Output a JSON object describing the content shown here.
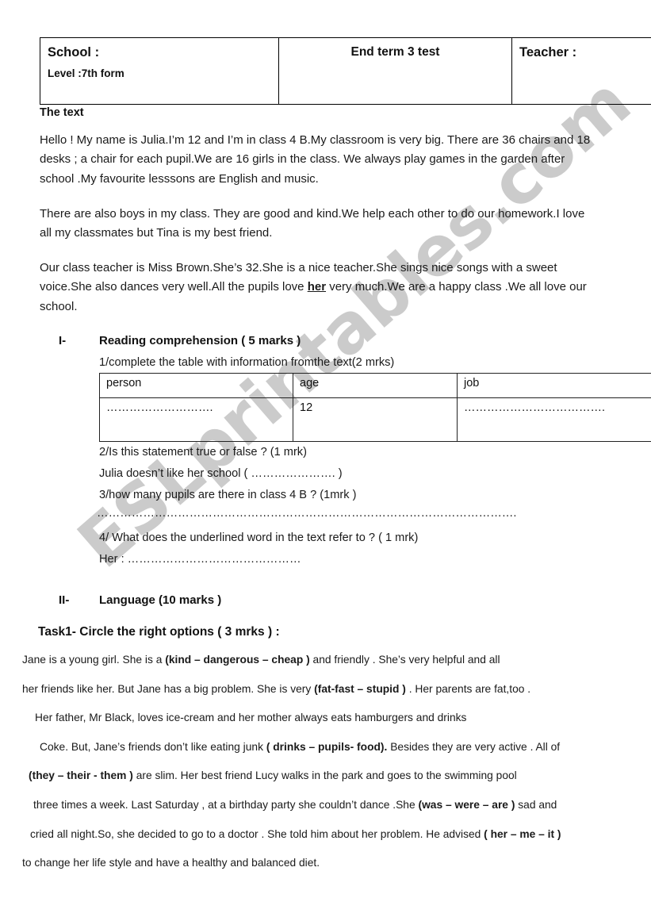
{
  "header": {
    "school_label": "School :",
    "level_label": "Level :7th form",
    "test_title": "End term 3 test",
    "teacher_label": "Teacher :"
  },
  "text_section": {
    "title": "The text",
    "paragraphs": [
      "Hello ! My name is Julia.I’m 12 and I’m in class 4 B.My classroom is very big. There are 36 chairs and 18 desks ; a chair for each pupil.We are 16 girls in the class. We always play games in the garden after school .My favourite lesssons are English and music.",
      "There are also boys in my class. They are good and kind.We help each other to do our homework.I love all my classmates but Tina is my best friend.",
      "Our class teacher is Miss Brown.She’s 32.She is a nice teacher.She sings nice songs with a sweet voice.She also dances very well.All the pupils  love ",
      " very much.We are a happy class .We all love our school."
    ],
    "underlined_word": "her"
  },
  "part_one": {
    "numeral": "I-",
    "title": "Reading comprehension ( 5 marks )",
    "q1": "1/complete the table with information fromthe text(2 mrks)",
    "table": {
      "headers": [
        "person",
        "age",
        "job"
      ],
      "row": [
        "……………………….",
        "12",
        "………………………………."
      ]
    },
    "q2_prompt": "2/Is this statement true or false ? (1 mrk)",
    "q2_statement": "Julia doesn’t like her school   ( …………………. )",
    "q3_prompt": "3/how many pupils are there in class 4 B ? (1mrk )",
    "q3_answer_dots": "……………………………………………………………………………………………….",
    "q4_prompt": "4/ What does the underlined word in the text refer to ? ( 1 mrk)",
    "q4_answer": "Her : ………………………………………"
  },
  "part_two": {
    "numeral": "II-",
    "title": "Language (10 marks )",
    "task1_heading": "Task1- Circle the right options ( 3 mrks ) :",
    "lines": [
      [
        {
          "t": "Jane is a  young girl. She is a ",
          "b": false
        },
        {
          "t": "(kind – dangerous – cheap )",
          "b": true
        },
        {
          "t": " and friendly . She’s very helpful and all",
          "b": false
        }
      ],
      [
        {
          "t": "her friends like her. But  Jane has a big problem. She is very ",
          "b": false
        },
        {
          "t": "(fat-fast – stupid )",
          "b": true
        },
        {
          "t": " . Her parents are fat,too .",
          "b": false
        }
      ],
      [
        {
          "t": "Her father, Mr Black, loves ice-cream and her mother always eats hamburgers and drinks",
          "b": false
        }
      ],
      [
        {
          "t": "Coke. But,  Jane’s friends don’t like eating junk ",
          "b": false
        },
        {
          "t": "( drinks – pupils- food).",
          "b": true
        },
        {
          "t": "  Besides they are very  active . All of",
          "b": false
        }
      ],
      [
        {
          "t": "(they – their - them )",
          "b": true
        },
        {
          "t": " are slim. Her best friend Lucy walks in the park  and  goes to the swimming pool",
          "b": false
        }
      ],
      [
        {
          "t": "three times a week. Last Saturday , at a birthday party she couldn’t dance .She ",
          "b": false
        },
        {
          "t": "(was – were – are )",
          "b": true
        },
        {
          "t": " sad and",
          "b": false
        }
      ],
      [
        {
          "t": "cried all night.So, she decided to go to a doctor . She told him about her problem. He advised ",
          "b": false
        },
        {
          "t": "( her – me – it )",
          "b": true
        }
      ],
      [
        {
          "t": "to change her life style and have a healthy and balanced diet.",
          "b": false
        }
      ]
    ],
    "line_indents": [
      28,
      28,
      44,
      50,
      36,
      42,
      38,
      28
    ]
  },
  "watermark": {
    "text": "ESLprintables.com",
    "color": "#c9c9c9"
  }
}
